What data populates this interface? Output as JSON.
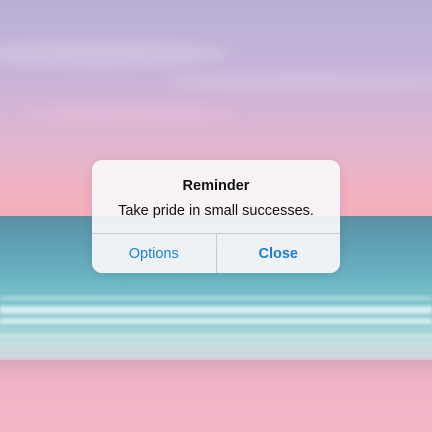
{
  "alert": {
    "title": "Reminder",
    "message": "Take pride in small successes.",
    "options_label": "Options",
    "close_label": "Close",
    "accent_color": "#1a7fd8"
  }
}
